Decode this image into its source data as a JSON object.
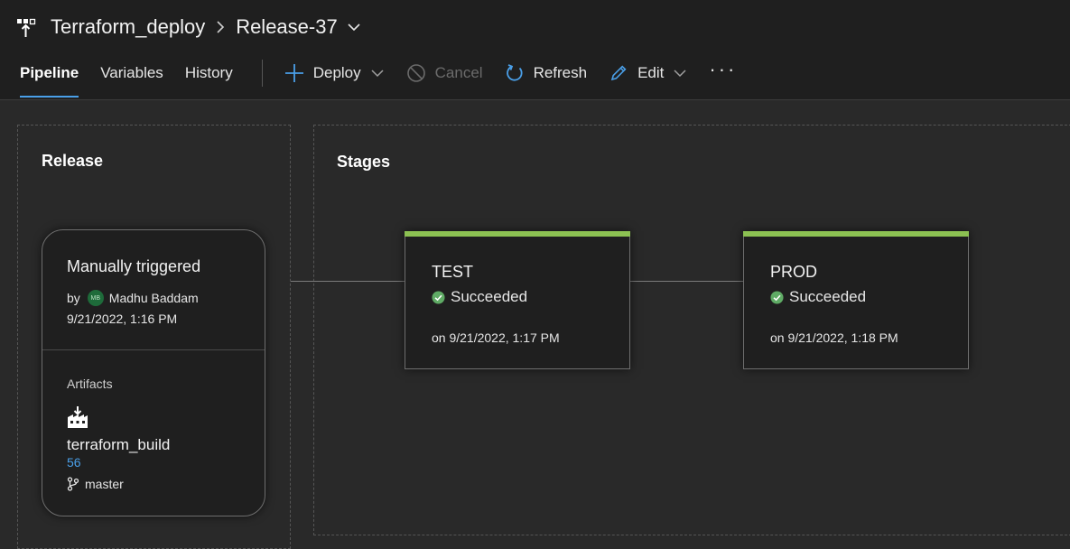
{
  "colors": {
    "accent": "#4a9fe8",
    "success": "#5fab65",
    "stage_bar": "#8cc152"
  },
  "breadcrumb": {
    "pipeline": "Terraform_deploy",
    "release": "Release-37"
  },
  "tabs": [
    "Pipeline",
    "Variables",
    "History"
  ],
  "toolbar": {
    "deploy": "Deploy",
    "cancel": "Cancel",
    "refresh": "Refresh",
    "edit": "Edit",
    "more": "···"
  },
  "release_panel": {
    "title": "Release",
    "trigger": "Manually triggered",
    "by_label": "by",
    "avatar_initials": "MB",
    "user": "Madhu Baddam",
    "date": "9/21/2022, 1:16 PM",
    "artifacts_label": "Artifacts",
    "build_name": "terraform_build",
    "build_number": "56",
    "branch": "master"
  },
  "stages_panel": {
    "title": "Stages",
    "stages": [
      {
        "name": "TEST",
        "status": "Succeeded",
        "date": "on 9/21/2022, 1:17 PM"
      },
      {
        "name": "PROD",
        "status": "Succeeded",
        "date": "on 9/21/2022, 1:18 PM"
      }
    ]
  }
}
